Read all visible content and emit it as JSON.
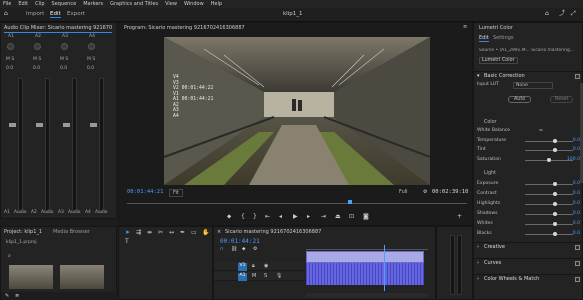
{
  "menu": [
    "File",
    "Edit",
    "Clip",
    "Sequence",
    "Markers",
    "Graphics and Titles",
    "View",
    "Window",
    "Help"
  ],
  "workspace": {
    "tabs": [
      "Import",
      "Edit",
      "Export"
    ],
    "active": "Edit",
    "project_name": "klip1_1"
  },
  "mixer": {
    "title": "Audio Clip Mixer: Sicario mastering 9216702416306",
    "channels": [
      "A1",
      "A2",
      "A3",
      "A4"
    ],
    "bottom_labels": [
      "A1",
      "Audio",
      "A2",
      "Audio",
      "A3",
      "Audio",
      "A4",
      "Audio"
    ],
    "db_values": [
      "0.0",
      "0.0",
      "0.0",
      "0.0"
    ]
  },
  "program": {
    "title": "Program: Sicario mastering 9216702416306887",
    "overlay_lines": [
      "V4",
      "V3",
      "V2 00:01:44:22",
      "V1",
      "A1 00:01:44:21",
      "A2",
      "A3",
      "A4"
    ],
    "timecode_left": "00:01:44:21",
    "fit_label": "Fit",
    "quality_label": "Full",
    "timecode_right": "00:02:39:10"
  },
  "project": {
    "tabs": [
      "Project: klip1_1",
      "Media Browser"
    ],
    "file": "klip1_1.prproj"
  },
  "timeline": {
    "title": "Sicario mastering 9216702416306887",
    "timecode": "00:01:44:21",
    "tracks": [
      "V1",
      "A1"
    ]
  },
  "lumetri": {
    "panel_title": "Lumetri Color",
    "tabs": [
      "Edit",
      "Settings"
    ],
    "source_line": "Source • (A1_2991.M… Sicario mastering…",
    "fx_label": "Lumetri Color",
    "basic_title": "Basic Correction",
    "input_lut_label": "Input LUT",
    "input_lut_value": "None",
    "auto_label": "Auto",
    "reset_label": "Reset",
    "color_title": "Color",
    "white_balance": "White Balance",
    "light_title": "Light",
    "rows": [
      {
        "label": "Temperature",
        "value": "0.0",
        "pos": 0.6
      },
      {
        "label": "Tint",
        "value": "0.0",
        "pos": 0.6
      },
      {
        "label": "Saturation",
        "value": "100.0",
        "pos": 0.5
      },
      {
        "label": "Exposure",
        "value": "0.0",
        "pos": 0.6
      },
      {
        "label": "Contrast",
        "value": "0.0",
        "pos": 0.6
      },
      {
        "label": "Highlights",
        "value": "0.0",
        "pos": 0.6
      },
      {
        "label": "Shadows",
        "value": "0.0",
        "pos": 0.6
      },
      {
        "label": "Whites",
        "value": "0.0",
        "pos": 0.6
      },
      {
        "label": "Blacks",
        "value": "0.0",
        "pos": 0.6
      }
    ],
    "sections": [
      "Creative",
      "Curves",
      "Color Wheels & Match"
    ]
  },
  "colors": {
    "accent": "#2d8ceb",
    "timecode": "#4c9eff",
    "audio_clip": "#5b5bd6",
    "video_clip": "#a9a9e8",
    "highlight": "#d8d8d8"
  }
}
